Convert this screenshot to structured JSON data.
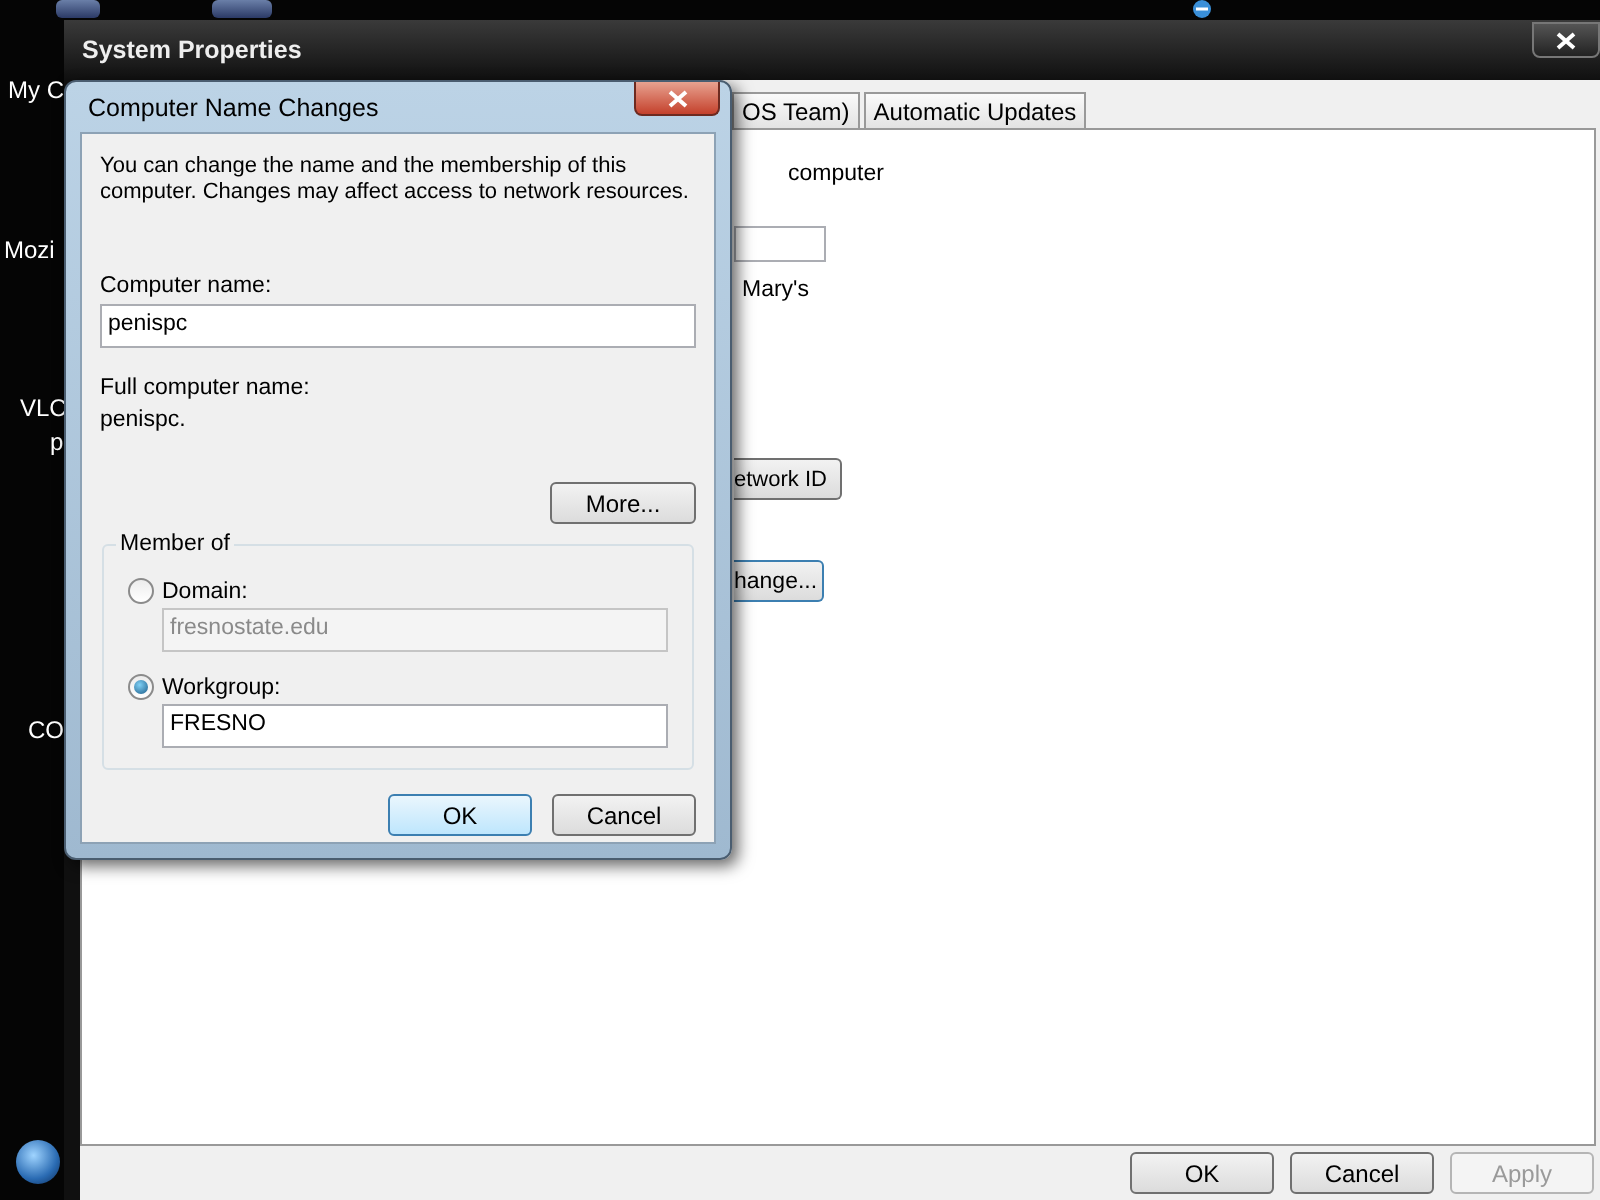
{
  "desktop": {
    "icons": [
      {
        "label": "My C"
      },
      {
        "label": "Mozi"
      },
      {
        "label": "VLC"
      },
      {
        "label": "p"
      },
      {
        "label": "CO"
      }
    ]
  },
  "system_properties": {
    "title": "System Properties",
    "tabs": [
      {
        "label": "OS Team)",
        "selected": false
      },
      {
        "label": "Automatic Updates",
        "selected": false
      }
    ],
    "visible_text": "computer",
    "note": "Mary's",
    "network_id_button": "etwork ID",
    "change_button": "hange...",
    "buttons": [
      {
        "label": "OK",
        "disabled": false
      },
      {
        "label": "Cancel",
        "disabled": false
      },
      {
        "label": "Apply",
        "disabled": true
      }
    ]
  },
  "dialog": {
    "title": "Computer Name Changes",
    "description": "You can change the name and the membership of this computer. Changes may affect access to network resources.",
    "computer_name_label": "Computer name:",
    "computer_name": "penispc",
    "full_name_label": "Full computer name:",
    "full_name": "penispc.",
    "more_button": "More...",
    "member_of": {
      "legend": "Member of",
      "options": [
        {
          "label": "Domain:",
          "selected": false,
          "value": "fresnostate.edu"
        },
        {
          "label": "Workgroup:",
          "selected": true,
          "value": "FRESNO"
        }
      ]
    },
    "buttons": [
      {
        "label": "OK",
        "default": true
      },
      {
        "label": "Cancel",
        "default": false
      }
    ]
  }
}
